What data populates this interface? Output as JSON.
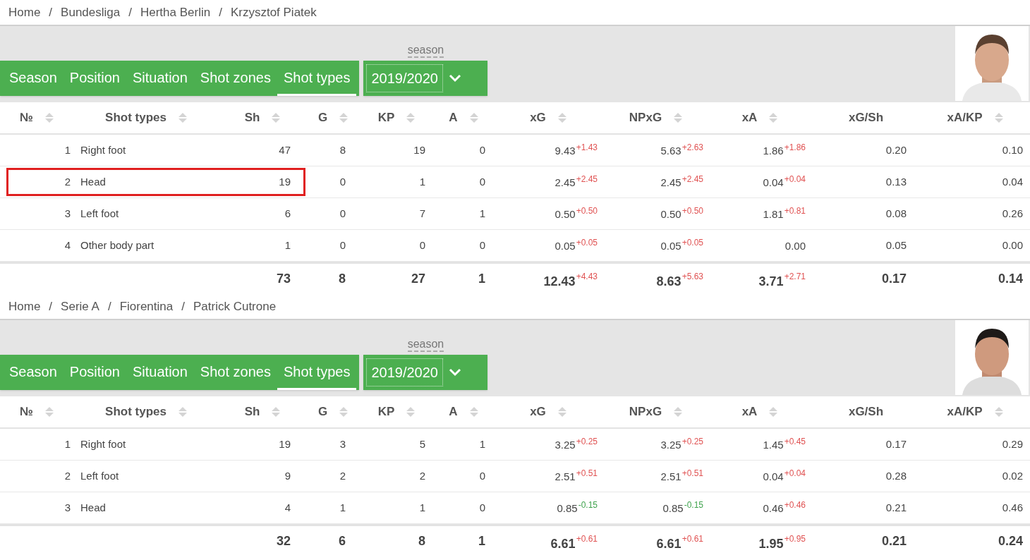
{
  "blocks": [
    {
      "breadcrumb": [
        "Home",
        "Bundesliga",
        "Hertha Berlin",
        "Krzysztof Piatek"
      ],
      "separator": "/",
      "tabs": [
        {
          "label": "Season",
          "selected": false
        },
        {
          "label": "Position",
          "selected": false
        },
        {
          "label": "Situation",
          "selected": false
        },
        {
          "label": "Shot zones",
          "selected": false
        },
        {
          "label": "Shot types",
          "selected": true
        }
      ],
      "season_label": "season",
      "season_value": "2019/2020",
      "photo": {
        "kind": "picture"
      },
      "columns": [
        "№",
        "Shot types",
        "Sh",
        "G",
        "KP",
        "A",
        "xG",
        "NPxG",
        "xA",
        "xG/Sh",
        "xA/KP"
      ],
      "rows": [
        {
          "no": "1",
          "type": "Right foot",
          "sh": "47",
          "g": "8",
          "kp": "19",
          "a": "0",
          "xg": {
            "value": "9.43",
            "delta": "+1.43",
            "color": "#e05252"
          },
          "npxg": {
            "value": "5.63",
            "delta": "+2.63",
            "color": "#e05252"
          },
          "xa": {
            "value": "1.86",
            "delta": "+1.86",
            "color": "#e05252"
          },
          "xg_sh": "0.20",
          "xa_kp": "0.10",
          "highlighted": false
        },
        {
          "no": "2",
          "type": "Head",
          "sh": "19",
          "g": "0",
          "kp": "1",
          "a": "0",
          "xg": {
            "value": "2.45",
            "delta": "+2.45",
            "color": "#e05252"
          },
          "npxg": {
            "value": "2.45",
            "delta": "+2.45",
            "color": "#e05252"
          },
          "xa": {
            "value": "0.04",
            "delta": "+0.04",
            "color": "#e05252"
          },
          "xg_sh": "0.13",
          "xa_kp": "0.04",
          "highlighted": true
        },
        {
          "no": "3",
          "type": "Left foot",
          "sh": "6",
          "g": "0",
          "kp": "7",
          "a": "1",
          "xg": {
            "value": "0.50",
            "delta": "+0.50",
            "color": "#e05252"
          },
          "npxg": {
            "value": "0.50",
            "delta": "+0.50",
            "color": "#e05252"
          },
          "xa": {
            "value": "1.81",
            "delta": "+0.81",
            "color": "#e05252"
          },
          "xg_sh": "0.08",
          "xa_kp": "0.26",
          "highlighted": false
        },
        {
          "no": "4",
          "type": "Other body part",
          "sh": "1",
          "g": "0",
          "kp": "0",
          "a": "0",
          "xg": {
            "value": "0.05",
            "delta": "+0.05",
            "color": "#e05252"
          },
          "npxg": {
            "value": "0.05",
            "delta": "+0.05",
            "color": "#e05252"
          },
          "xa": {
            "value": "0.00"
          },
          "xg_sh": "0.05",
          "xa_kp": "0.00",
          "highlighted": false
        }
      ],
      "total": {
        "sh": "73",
        "g": "8",
        "kp": "27",
        "a": "1",
        "xg": {
          "value": "12.43",
          "delta": "+4.43",
          "color": "#e05252"
        },
        "npxg": {
          "value": "8.63",
          "delta": "+5.63",
          "color": "#e05252"
        },
        "xa": {
          "value": "3.71",
          "delta": "+2.71",
          "color": "#e05252"
        },
        "xg_sh": "0.17",
        "xa_kp": "0.14"
      }
    },
    {
      "breadcrumb": [
        "Home",
        "Serie A",
        "Fiorentina",
        "Patrick Cutrone"
      ],
      "separator": "/",
      "tabs": [
        {
          "label": "Season",
          "selected": false
        },
        {
          "label": "Position",
          "selected": false
        },
        {
          "label": "Situation",
          "selected": false
        },
        {
          "label": "Shot zones",
          "selected": false
        },
        {
          "label": "Shot types",
          "selected": true
        }
      ],
      "season_label": "season",
      "season_value": "2019/2020",
      "photo": {
        "kind": "picture"
      },
      "columns": [
        "№",
        "Shot types",
        "Sh",
        "G",
        "KP",
        "A",
        "xG",
        "NPxG",
        "xA",
        "xG/Sh",
        "xA/KP"
      ],
      "rows": [
        {
          "no": "1",
          "type": "Right foot",
          "sh": "19",
          "g": "3",
          "kp": "5",
          "a": "1",
          "xg": {
            "value": "3.25",
            "delta": "+0.25",
            "color": "#e05252"
          },
          "npxg": {
            "value": "3.25",
            "delta": "+0.25",
            "color": "#e05252"
          },
          "xa": {
            "value": "1.45",
            "delta": "+0.45",
            "color": "#e05252"
          },
          "xg_sh": "0.17",
          "xa_kp": "0.29",
          "highlighted": false
        },
        {
          "no": "2",
          "type": "Left foot",
          "sh": "9",
          "g": "2",
          "kp": "2",
          "a": "0",
          "xg": {
            "value": "2.51",
            "delta": "+0.51",
            "color": "#e05252"
          },
          "npxg": {
            "value": "2.51",
            "delta": "+0.51",
            "color": "#e05252"
          },
          "xa": {
            "value": "0.04",
            "delta": "+0.04",
            "color": "#e05252"
          },
          "xg_sh": "0.28",
          "xa_kp": "0.02",
          "highlighted": false
        },
        {
          "no": "3",
          "type": "Head",
          "sh": "4",
          "g": "1",
          "kp": "1",
          "a": "0",
          "xg": {
            "value": "0.85",
            "delta": "-0.15",
            "color": "#3fa34d"
          },
          "npxg": {
            "value": "0.85",
            "delta": "-0.15",
            "color": "#3fa34d"
          },
          "xa": {
            "value": "0.46",
            "delta": "+0.46",
            "color": "#e05252"
          },
          "xg_sh": "0.21",
          "xa_kp": "0.46",
          "highlighted": false
        }
      ],
      "total": {
        "sh": "32",
        "g": "6",
        "kp": "8",
        "a": "1",
        "xg": {
          "value": "6.61",
          "delta": "+0.61",
          "color": "#e05252"
        },
        "npxg": {
          "value": "6.61",
          "delta": "+0.61",
          "color": "#e05252"
        },
        "xa": {
          "value": "1.95",
          "delta": "+0.95",
          "color": "#e05252"
        },
        "xg_sh": "0.21",
        "xa_kp": "0.24"
      }
    }
  ]
}
